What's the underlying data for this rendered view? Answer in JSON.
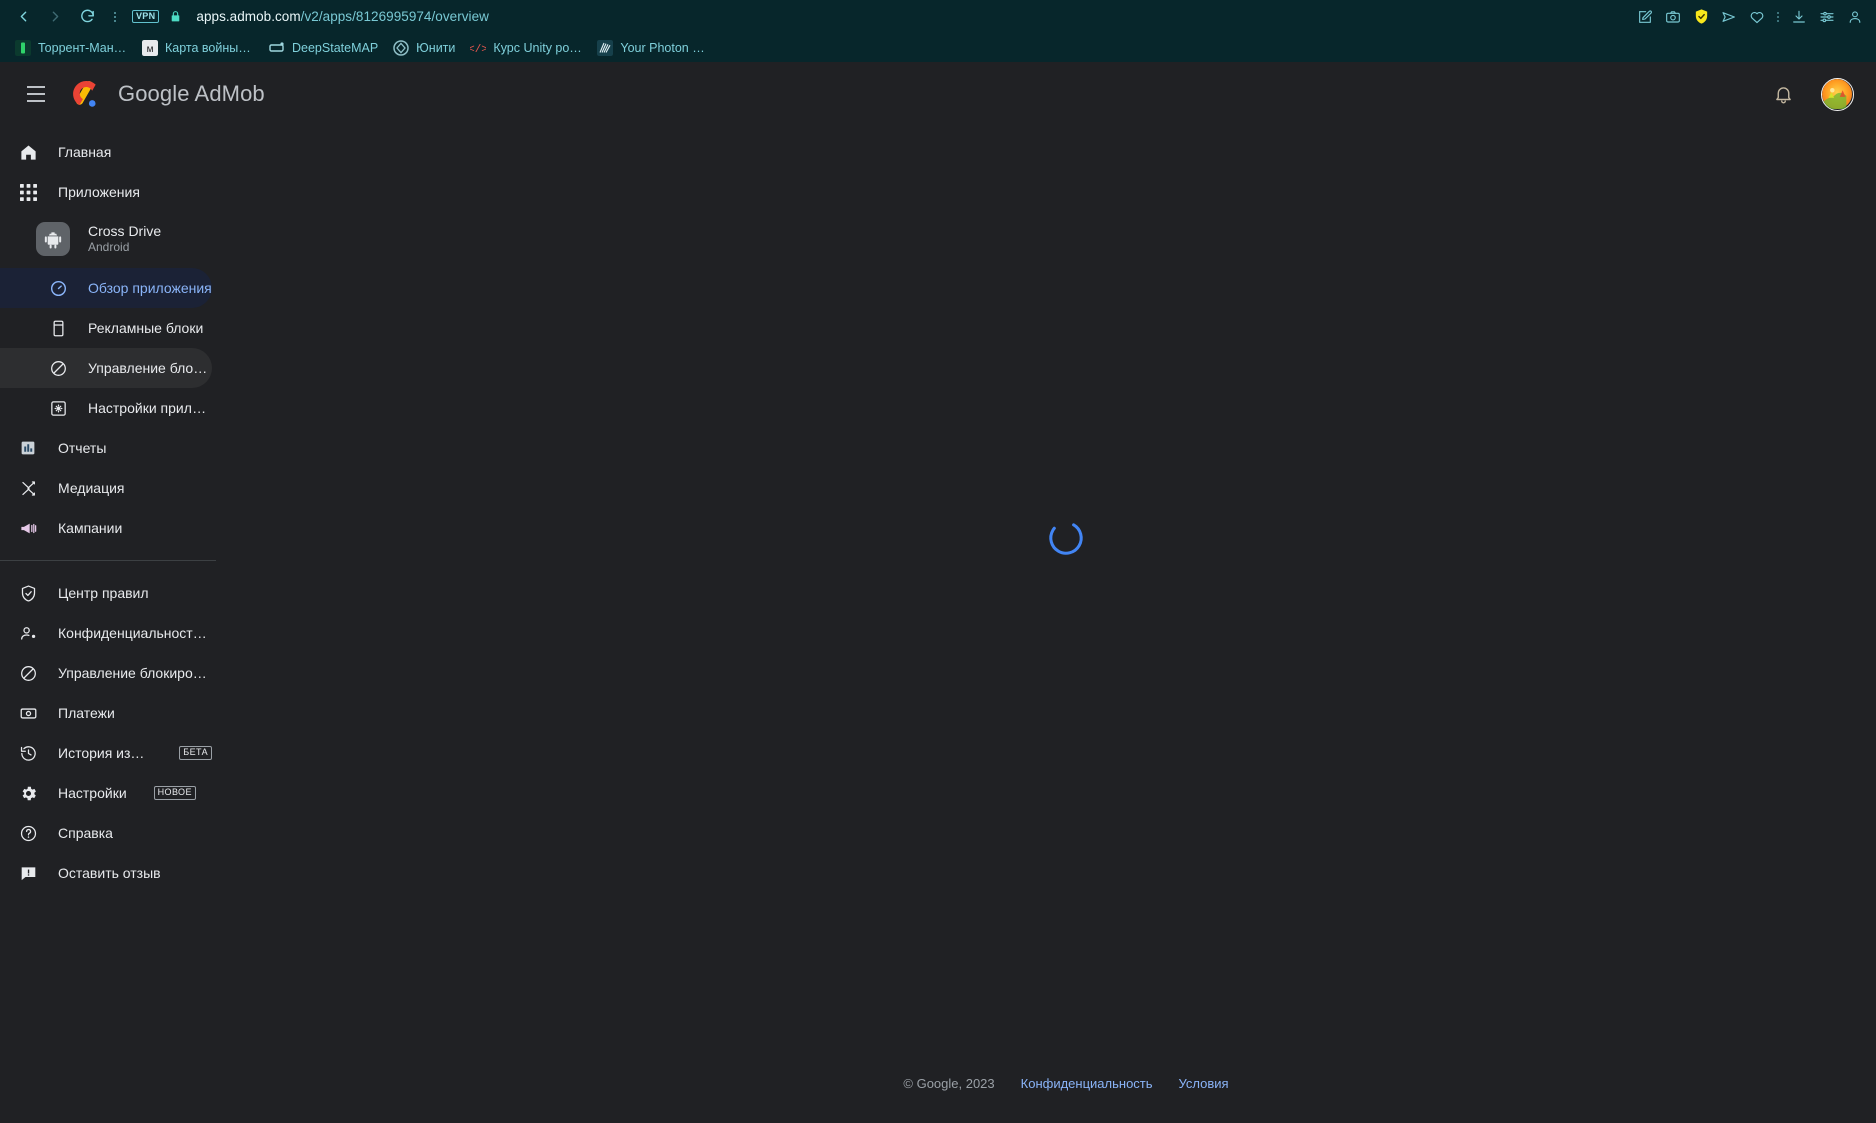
{
  "browser": {
    "nav": {
      "back_label": "back-arrow",
      "forward_label": "forward-arrow",
      "reload_label": "reload"
    },
    "vpn_chip": "VPN",
    "url": {
      "host": "apps.admob.com",
      "path": "/v2/apps/8126995974/overview",
      "full": "apps.admob.com/v2/apps/8126995974/overview"
    },
    "bookmarks": [
      {
        "label": "Торрент-Мания -...",
        "icon": "green-square-favicon",
        "color": "#2fd36a"
      },
      {
        "label": "Карта войны в Укр...",
        "icon": "map-favicon",
        "color": "#e8eaed"
      },
      {
        "label": "DeepStateMAP",
        "icon": "deepstate-favicon",
        "color": "#9fd8e0"
      },
      {
        "label": "Юнити",
        "icon": "unity-favicon",
        "color": "#8fbfc7"
      },
      {
        "label": "Курс Unity розроб...",
        "icon": "code-tag-favicon",
        "color": "#e8574f"
      },
      {
        "label": "Your Photon Cloud...",
        "icon": "photon-favicon",
        "color": "#cfe8ef"
      }
    ],
    "actions": [
      "edit-annotate-icon",
      "camera-icon",
      "shield-check-icon",
      "send-icon",
      "heart-icon",
      "more-vertical-icon",
      "download-icon",
      "sliders-icon",
      "profile-icon"
    ]
  },
  "header": {
    "menu_label": "menu",
    "brand_google": "Google",
    "brand_product": "AdMob",
    "notifications_label": "notifications",
    "avatar_label": "account-avatar"
  },
  "sidebar": {
    "top_items": [
      {
        "label": "Главная",
        "icon": "home-icon"
      },
      {
        "label": "Приложения",
        "icon": "apps-grid-icon"
      }
    ],
    "app": {
      "name": "Cross Drive",
      "platform": "Android",
      "icon": "android-icon"
    },
    "app_items": [
      {
        "label": "Обзор приложения",
        "icon": "speedometer-icon",
        "state": "active"
      },
      {
        "label": "Рекламные блоки",
        "icon": "ad-unit-icon",
        "state": "normal"
      },
      {
        "label": "Управление блокиров...",
        "icon": "block-icon",
        "state": "hovered"
      },
      {
        "label": "Настройки приложения",
        "icon": "app-settings-icon",
        "state": "normal"
      }
    ],
    "mid_items": [
      {
        "label": "Отчеты",
        "icon": "bar-chart-icon"
      },
      {
        "label": "Медиация",
        "icon": "mediation-icon"
      },
      {
        "label": "Кампании",
        "icon": "megaphone-icon"
      }
    ],
    "bottom_items": [
      {
        "label": "Центр правил",
        "icon": "shield-check-icon",
        "badge": ""
      },
      {
        "label": "Конфиденциальность и со...",
        "icon": "person-settings-icon",
        "badge": ""
      },
      {
        "label": "Управление блокировкой",
        "icon": "block-icon",
        "badge": ""
      },
      {
        "label": "Платежи",
        "icon": "payments-icon",
        "badge": ""
      },
      {
        "label": "История изменений",
        "icon": "history-icon",
        "badge": "БЕТА"
      },
      {
        "label": "Настройки",
        "icon": "gear-icon",
        "badge": "НОВОЕ"
      },
      {
        "label": "Справка",
        "icon": "help-icon",
        "badge": ""
      },
      {
        "label": "Оставить отзыв",
        "icon": "feedback-icon",
        "badge": ""
      }
    ]
  },
  "main": {
    "loading_label": "loading-spinner"
  },
  "footer": {
    "copyright": "© Google, 2023",
    "privacy": "Конфиденциальность",
    "terms": "Условия"
  },
  "colors": {
    "chrome_bg": "#07262b",
    "app_bg": "#202124",
    "accent_blue": "#8ab4f8",
    "active_pill": "#1b2236",
    "text_primary": "#e8eaed",
    "text_secondary": "#9aa0a6"
  }
}
